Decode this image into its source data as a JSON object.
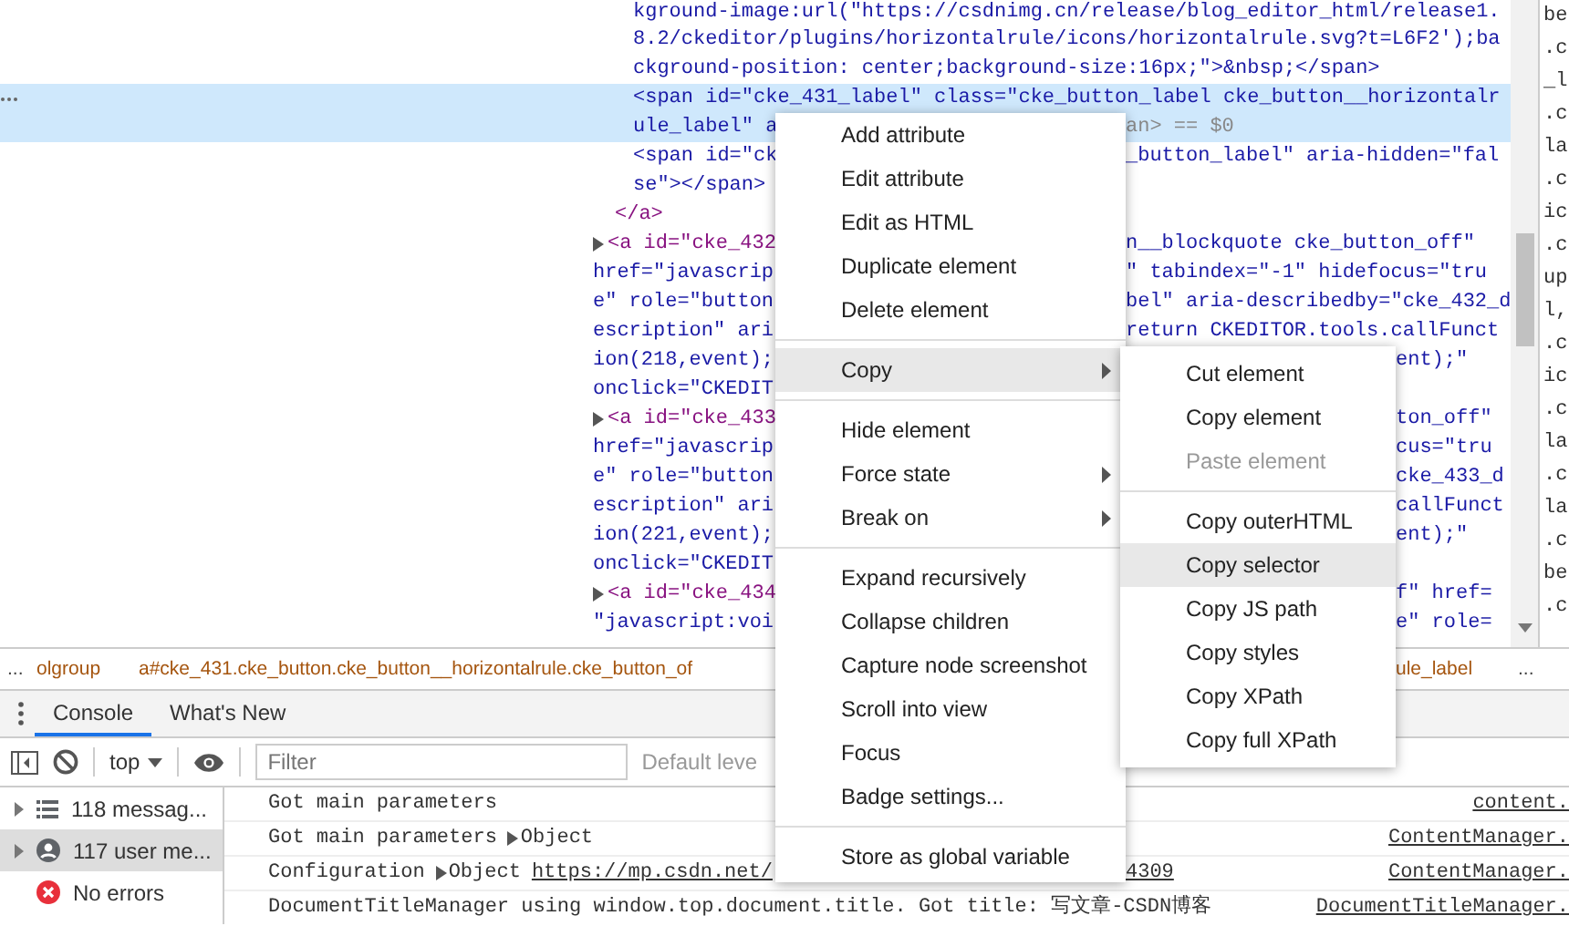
{
  "elements_panel": {
    "code_lines": [
      {
        "kind": "wrap-indent",
        "text": "kground-image:url(\"https://csdnimg.cn/release/blog_editor_html/release1.",
        "selected": false
      },
      {
        "kind": "wrap-indent",
        "text": "8.2/ckeditor/plugins/horizontalrule/icons/horizontalrule.svg?t=L6F2');ba",
        "selected": false
      },
      {
        "kind": "wrap-indent",
        "text": "ckground-position: center;background-size:16px;\">&nbsp;</span>",
        "selected": false
      },
      {
        "kind": "wrap-indent",
        "text": "<span id=\"cke_431_label\" class=\"cke_button_label cke_button__horizontalr",
        "selected": true
      },
      {
        "kind": "wrap-indent",
        "text": "ule_label\" a",
        "after_menu": "an> == $0",
        "selected": true
      },
      {
        "kind": "wrap-indent",
        "text": "<span id=\"ck",
        "after_menu": "_button_label\" aria-hidden=\"fal",
        "selected": false
      },
      {
        "kind": "wrap-indent",
        "text": "se\"></span>",
        "selected": false
      },
      {
        "kind": "close",
        "text": "</a>",
        "selected": false
      },
      {
        "kind": "node",
        "text": "<a id=\"cke_432",
        "after_menu": "n__blockquote cke_button_off\"",
        "selected": false
      },
      {
        "kind": "wrap",
        "text": "href=\"javascrip",
        "after_menu": "\" tabindex=\"-1\" hidefocus=\"tru",
        "selected": false
      },
      {
        "kind": "wrap",
        "text": "e\" role=\"button",
        "after_menu": "bel\" aria-describedby=\"cke_432_d",
        "selected": false
      },
      {
        "kind": "wrap",
        "text": "escription\" ari",
        "after_menu": "return CKEDITOR.tools.callFunct",
        "selected": false
      },
      {
        "kind": "wrap",
        "text": "ion(218,event);",
        "after_submenu": "ent);\"",
        "selected": false
      },
      {
        "kind": "wrap",
        "text": "onclick=\"CKEDIT",
        "selected": false
      },
      {
        "kind": "node",
        "text": "<a id=\"cke_433",
        "after_submenu": "ton_off\"",
        "selected": false
      },
      {
        "kind": "wrap",
        "text": "href=\"javascrip",
        "after_submenu": "cus=\"tru",
        "selected": false
      },
      {
        "kind": "wrap",
        "text": "e\" role=\"button",
        "after_submenu": "cke_433_d",
        "selected": false
      },
      {
        "kind": "wrap",
        "text": "escription\" ari",
        "after_submenu": "callFunct",
        "selected": false
      },
      {
        "kind": "wrap",
        "text": "ion(221,event);",
        "after_submenu": "ent);\"",
        "selected": false
      },
      {
        "kind": "wrap",
        "text": "onclick=\"CKEDIT",
        "selected": false
      },
      {
        "kind": "node",
        "text": "<a id=\"cke_434",
        "after_submenu": "f\" href=",
        "selected": false
      },
      {
        "kind": "wrap",
        "text": "\"javascript:voi",
        "after_submenu": "e\" role=",
        "selected": false
      }
    ],
    "styles_fragments": [
      "be",
      ".c",
      "_l",
      ".c",
      "la",
      ".c",
      "ic",
      ".c",
      "up",
      "l,",
      ".c",
      "ic",
      ".c",
      "la",
      ".c",
      "la",
      ".c",
      "be",
      ".c"
    ],
    "breadcrumbs": {
      "more": "...",
      "items": [
        "olgroup",
        "a#cke_431.cke_button.cke_button__horizontalrule.cke_button_of"
      ],
      "after_submenu": "ule_label",
      "overflow": "..."
    }
  },
  "drawer": {
    "tabs": [
      {
        "label": "Console",
        "selected": true
      },
      {
        "label": "What's New",
        "selected": false
      }
    ],
    "toolbar": {
      "context": "top",
      "filter_placeholder": "Filter",
      "levels": "Default leve"
    },
    "sidebar": [
      {
        "kind": "messages",
        "label": "118 messag...",
        "selected": false
      },
      {
        "kind": "user",
        "label": "117 user me...",
        "selected": true
      },
      {
        "kind": "errors",
        "label": "No errors",
        "selected": false
      }
    ],
    "messages": [
      {
        "text": "Got main parameters",
        "source": "content."
      },
      {
        "text": "Got main parameters",
        "object": "Object",
        "source": "ContentManager."
      },
      {
        "text": "Configuration",
        "object": "Object",
        "link": "https://mp.csdn.net/",
        "link_after_menu": "4309",
        "source": "ContentManager."
      },
      {
        "text": "DocumentTitleManager using window.top.document.title. Got title:  写文章-CSDN博客",
        "source": "DocumentTitleManager."
      }
    ]
  },
  "context_menu": {
    "groups": [
      [
        {
          "label": "Add attribute",
          "selected": false,
          "submenu": false
        },
        {
          "label": "Edit attribute",
          "selected": false,
          "submenu": false
        },
        {
          "label": "Edit as HTML",
          "selected": false,
          "submenu": false
        },
        {
          "label": "Duplicate element",
          "selected": false,
          "submenu": false
        },
        {
          "label": "Delete element",
          "selected": false,
          "submenu": false
        }
      ],
      [
        {
          "label": "Copy",
          "selected": true,
          "submenu": true
        }
      ],
      [
        {
          "label": "Hide element",
          "selected": false,
          "submenu": false
        },
        {
          "label": "Force state",
          "selected": false,
          "submenu": true
        },
        {
          "label": "Break on",
          "selected": false,
          "submenu": true
        }
      ],
      [
        {
          "label": "Expand recursively",
          "selected": false,
          "submenu": false
        },
        {
          "label": "Collapse children",
          "selected": false,
          "submenu": false
        },
        {
          "label": "Capture node screenshot",
          "selected": false,
          "submenu": false
        },
        {
          "label": "Scroll into view",
          "selected": false,
          "submenu": false
        },
        {
          "label": "Focus",
          "selected": false,
          "submenu": false
        },
        {
          "label": "Badge settings...",
          "selected": false,
          "submenu": false
        }
      ],
      [
        {
          "label": "Store as global variable",
          "selected": false,
          "submenu": false
        }
      ]
    ]
  },
  "copy_submenu": {
    "groups": [
      [
        {
          "label": "Cut element",
          "selected": false,
          "disabled": false
        },
        {
          "label": "Copy element",
          "selected": false,
          "disabled": false
        },
        {
          "label": "Paste element",
          "selected": false,
          "disabled": true
        }
      ],
      [
        {
          "label": "Copy outerHTML",
          "selected": false,
          "disabled": false
        },
        {
          "label": "Copy selector",
          "selected": true,
          "disabled": false
        },
        {
          "label": "Copy JS path",
          "selected": false,
          "disabled": false
        },
        {
          "label": "Copy styles",
          "selected": false,
          "disabled": false
        },
        {
          "label": "Copy XPath",
          "selected": false,
          "disabled": false
        },
        {
          "label": "Copy full XPath",
          "selected": false,
          "disabled": false
        }
      ]
    ]
  }
}
